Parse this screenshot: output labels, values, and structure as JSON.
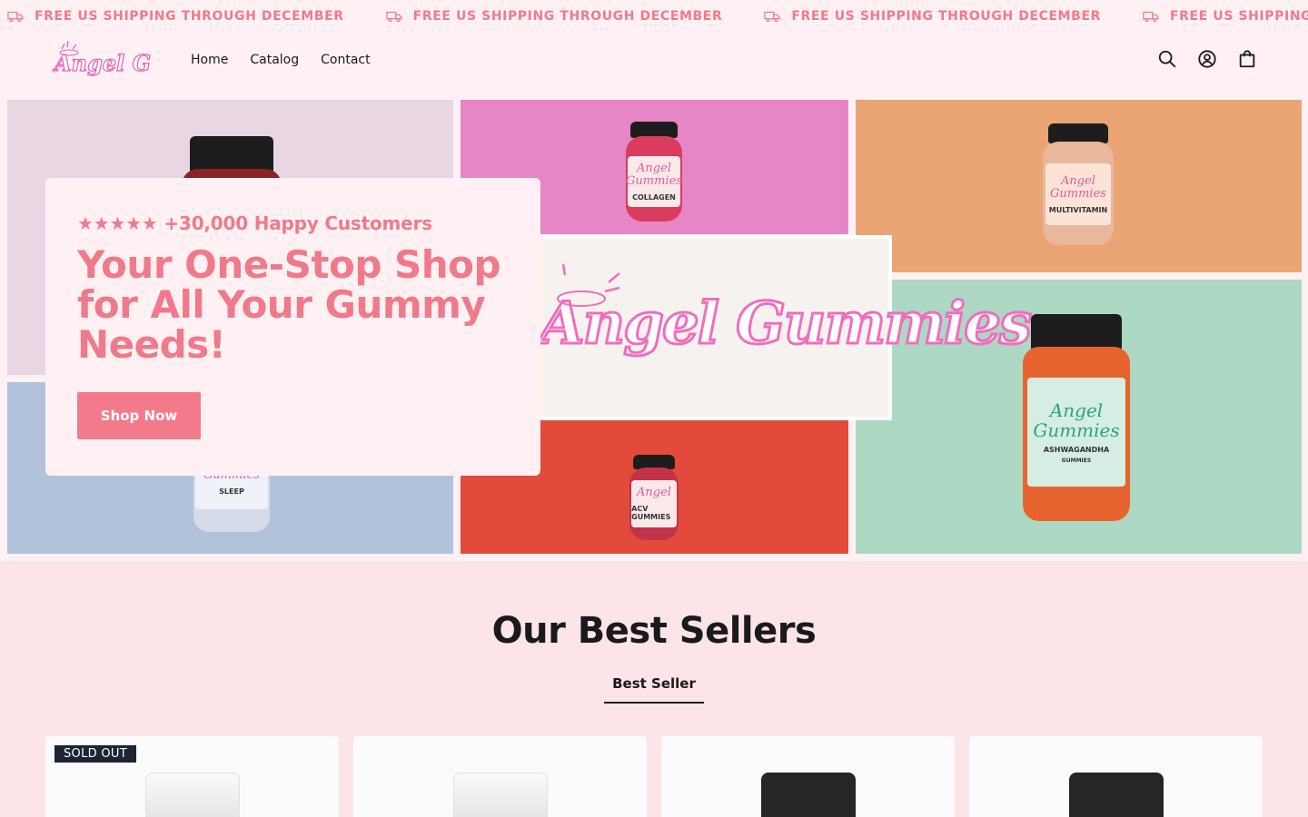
{
  "announcement": {
    "text": "FREE US SHIPPING THROUGH DECEMBER",
    "icon": "truck-icon",
    "color": "#f07a8a"
  },
  "header": {
    "logo_text": "Angel Gummies",
    "nav": [
      "Home",
      "Catalog",
      "Contact"
    ],
    "icons": [
      "search-icon",
      "account-icon",
      "cart-icon"
    ]
  },
  "hero": {
    "tiles": [
      {
        "name": "collagen",
        "label": "COLLAGEN",
        "color": "#e786c6"
      },
      {
        "name": "multivitamin",
        "label": "MULTIVITAMIN",
        "color": "#eba575"
      },
      {
        "name": "sleep",
        "label": "SLEEP",
        "color": "#b1c3db"
      },
      {
        "name": "acv",
        "label": "ACV GUMMIES",
        "color": "#e24b3b"
      },
      {
        "name": "ashwagandha",
        "label": "ASHWAGANDHA",
        "sublabel": "GUMMIES",
        "color": "#acd8c4"
      }
    ],
    "banner_text": "Angel Gummies",
    "rating_stars": "★★★★★",
    "rating_text": "+30,000 Happy Customers",
    "title": "Your One-Stop Shop for All Your Gummy Needs!",
    "button": "Shop Now",
    "accent": "#f37a8a"
  },
  "best_sellers": {
    "title": "Our Best Sellers",
    "tab": "Best Seller",
    "cards": [
      {
        "badge": "SOLD OUT",
        "cap": "white"
      },
      {
        "badge": "",
        "cap": "white"
      },
      {
        "badge": "",
        "cap": "black"
      },
      {
        "badge": "",
        "cap": "black"
      }
    ]
  }
}
